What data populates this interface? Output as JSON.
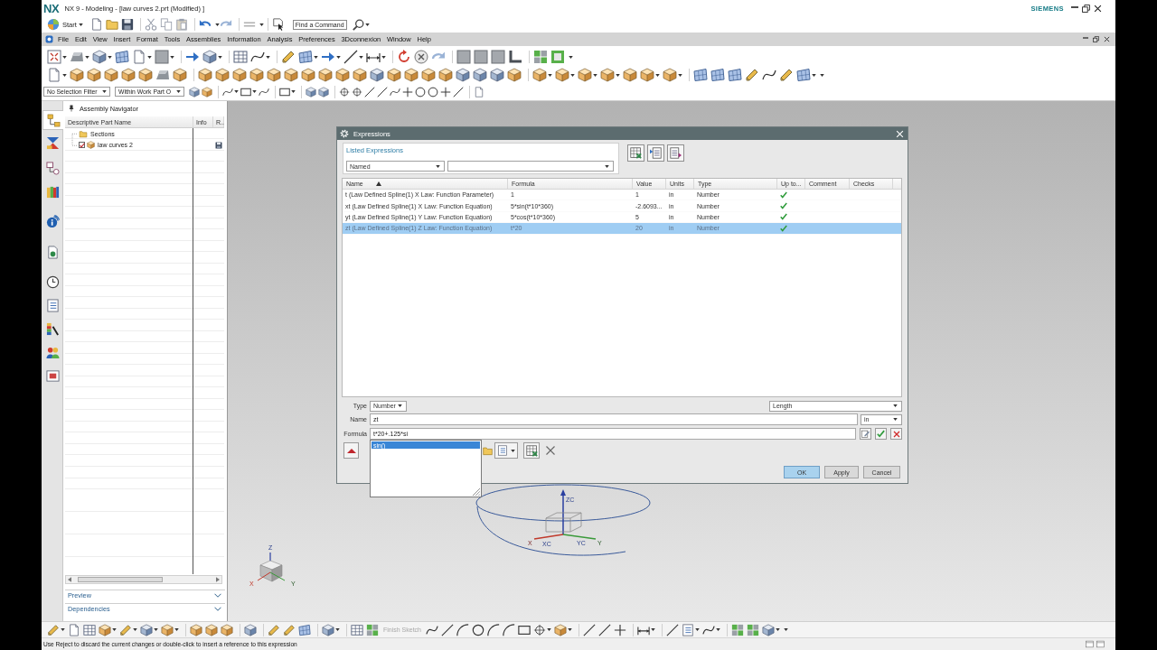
{
  "window": {
    "logo": "NX",
    "title": "NX 9 - Modeling - [law curves 2.prt (Modified) ]",
    "brand": "SIEMENS"
  },
  "quick_access": {
    "start": "Start",
    "command_search": {
      "placeholder": "Find a Command"
    }
  },
  "menu_bar": [
    "File",
    "Edit",
    "View",
    "Insert",
    "Format",
    "Tools",
    "Assemblies",
    "Information",
    "Analysis",
    "Preferences",
    "3Dconnexion",
    "Window",
    "Help"
  ],
  "selection_bar": {
    "type_filter": "No Selection Filter",
    "scope": "Within Work Part O"
  },
  "resource_bar": {
    "tabs": [
      {
        "selected": true
      },
      {
        "selected": false
      },
      {
        "selected": false
      },
      {
        "selected": false
      },
      {
        "selected": false
      },
      {
        "selected": false
      },
      {
        "selected": false
      },
      {
        "selected": false
      },
      {
        "selected": false
      },
      {
        "selected": false
      },
      {
        "selected": false
      }
    ]
  },
  "navigator": {
    "title": "Assembly Navigator",
    "columns": [
      "Descriptive Part Name",
      "Info",
      "R.."
    ],
    "nodes": [
      {
        "kind": "folder",
        "label": "Sections"
      },
      {
        "kind": "part",
        "label": "law curves 2",
        "checked": true
      }
    ],
    "panels": [
      {
        "label": "Preview",
        "expanded": false
      },
      {
        "label": "Dependencies",
        "expanded": false
      }
    ]
  },
  "dialog": {
    "title": "Expressions",
    "listed_expressions": {
      "label": "Listed Expressions",
      "filter": "Named"
    },
    "table": {
      "columns": [
        {
          "label": "Name",
          "sorted": true
        },
        {
          "label": "Formula",
          "sorted": false
        },
        {
          "label": "Value",
          "sorted": false
        },
        {
          "label": "Units",
          "sorted": false
        },
        {
          "label": "Type",
          "sorted": false
        },
        {
          "label": "Up to...",
          "sorted": false
        },
        {
          "label": "Comment",
          "sorted": false
        },
        {
          "label": "Checks",
          "sorted": false
        }
      ],
      "rows": [
        {
          "name": "t (Law Defined Spline(1) X Law: Function Parameter)",
          "formula": "1",
          "value": "1",
          "units": "in",
          "type": "Number",
          "up_to_date": true,
          "selected": false
        },
        {
          "name": "xt (Law Defined Spline(1) X Law: Function Equation)",
          "formula": "5*sin(t*10*360)",
          "value": "-2.6093...",
          "units": "in",
          "type": "Number",
          "up_to_date": true,
          "selected": false
        },
        {
          "name": "yt (Law Defined Spline(1) Y Law: Function Equation)",
          "formula": "5*cos(t*10*360)",
          "value": "5",
          "units": "in",
          "type": "Number",
          "up_to_date": true,
          "selected": false
        },
        {
          "name": "zt (Law Defined Spline(1) Z Law: Function Equation)",
          "formula": "t*20",
          "value": "20",
          "units": "in",
          "type": "Number",
          "up_to_date": true,
          "selected": true
        }
      ]
    },
    "type_field": {
      "label": "Type",
      "value": "Number"
    },
    "dimensionality": "Length",
    "name_field": {
      "label": "Name",
      "value": "zt",
      "units": "in"
    },
    "formula_field": {
      "label": "Formula",
      "value": "t*20+.125*si"
    },
    "suggestions": [
      {
        "label": "sin()",
        "selected": true
      }
    ],
    "buttons": [
      {
        "label": "OK",
        "default": true
      },
      {
        "label": "Apply",
        "default": false
      },
      {
        "label": "Cancel",
        "default": false
      }
    ]
  },
  "viewport": {
    "wcs_labels": {
      "z": "ZC",
      "x": "XC",
      "y": "YC"
    },
    "helix_axis_labels": {
      "x": "X",
      "y": "Y"
    },
    "triad_labels": {
      "z": "Z",
      "x": "X",
      "y": "Y"
    }
  },
  "sketch_toolbar": {
    "finish_sketch": {
      "label": "Finish Sketch",
      "disabled": true
    }
  },
  "status_bar": {
    "message": "Use Reject to discard the current changes or double-click to insert a reference to this expression"
  }
}
